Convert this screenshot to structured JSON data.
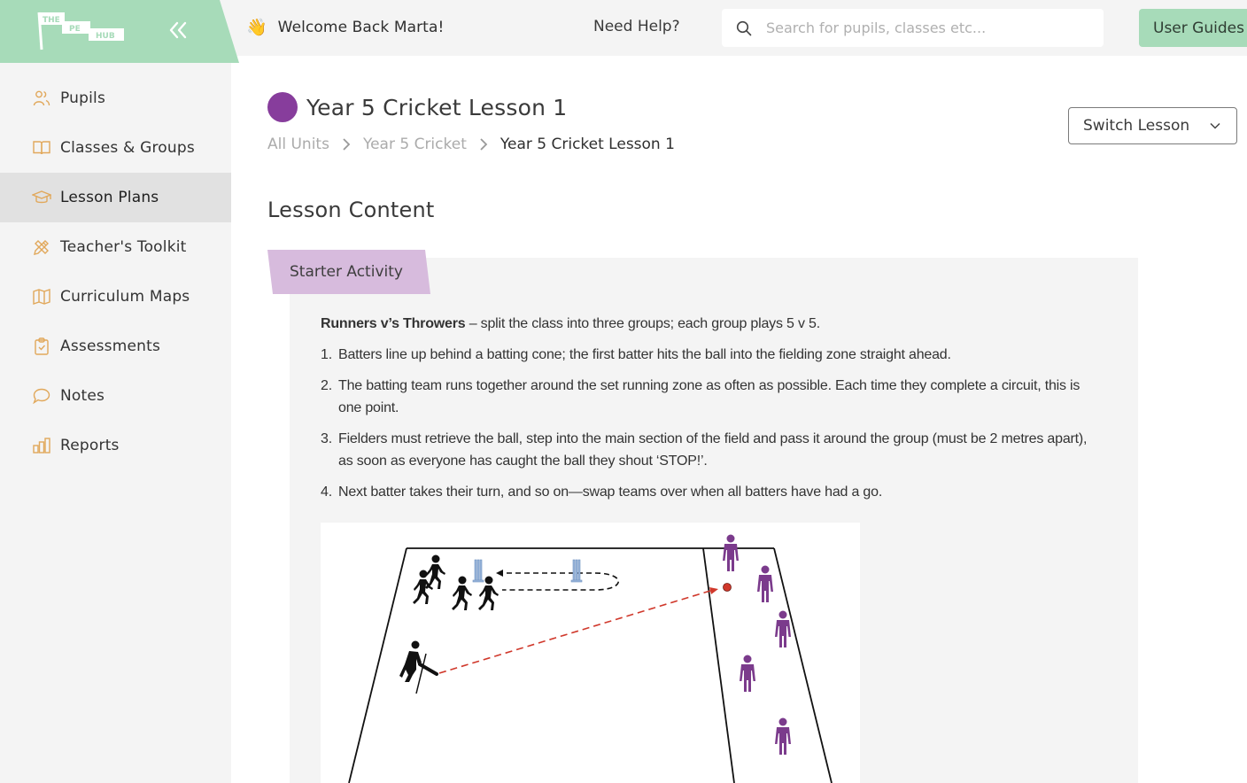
{
  "header": {
    "brand": {
      "line1": "THE",
      "line2": "PE",
      "line3": "HUB"
    },
    "collapse_icon": "double-chevron-left",
    "welcome_icon": "👋",
    "welcome_text": "Welcome Back Marta!",
    "help_link": "Need Help?",
    "search": {
      "placeholder": "Search for pupils, classes etc...",
      "value": ""
    },
    "user_guides_label": "User Guides"
  },
  "sidebar": {
    "items": [
      {
        "label": "Pupils",
        "icon": "users-icon",
        "active": false
      },
      {
        "label": "Classes & Groups",
        "icon": "book-icon",
        "active": false
      },
      {
        "label": "Lesson Plans",
        "icon": "graduation-cap-icon",
        "active": true
      },
      {
        "label": "Teacher's Toolkit",
        "icon": "tools-icon",
        "active": false
      },
      {
        "label": "Curriculum Maps",
        "icon": "map-icon",
        "active": false
      },
      {
        "label": "Assessments",
        "icon": "clipboard-check-icon",
        "active": false
      },
      {
        "label": "Notes",
        "icon": "chat-bubble-icon",
        "active": false
      },
      {
        "label": "Reports",
        "icon": "bar-chart-icon",
        "active": false
      }
    ],
    "icon_color": "#e1a85b"
  },
  "page": {
    "title": "Year 5 Cricket Lesson 1",
    "title_dot_color": "#873d9c",
    "breadcrumb": [
      "All Units",
      "Year 5 Cricket",
      "Year 5 Cricket Lesson 1"
    ],
    "switch_lesson_label": "Switch Lesson",
    "section_title": "Lesson Content"
  },
  "activity": {
    "tab_label": "Starter Activity",
    "intro_bold": "Runners v’s Throwers",
    "intro_rest": " – split the class into three groups; each group plays 5 v 5.",
    "steps": [
      {
        "num": "1.",
        "text": "Batters line up behind a batting cone; the first batter hits the ball into the fielding zone straight ahead."
      },
      {
        "num": "2.",
        "text": "The batting team runs together around the set running zone as often as possible. Each time they complete a circuit, this is one point."
      },
      {
        "num": "3.",
        "text": "Fielders must retrieve the ball, step into the main section of the field and pass it around the group (must be 2 metres apart), as soon as everyone has caught the ball they shout ‘STOP!’."
      },
      {
        "num": "4.",
        "text": "Next batter takes their turn, and so on—swap teams over when all batters have had a go."
      }
    ],
    "diagram": {
      "description": "Cricket field diagram: batting team (black runners) running around wickets, batter hitting ball (red dashed line) to fielding zone with purple fielders",
      "runners_count": 4,
      "batters_count": 1,
      "fielders_count": 5,
      "wickets_count": 2,
      "fielder_color": "#7b3b8c",
      "ball_color": "#d0382b",
      "wicket_color": "#8fb1d9"
    }
  },
  "colors": {
    "brand_green": "#a7dbb9",
    "tab_purple": "#d7bbdd",
    "sidebar_bg": "#f4f4f4",
    "sidebar_active": "#e1e1e1"
  }
}
